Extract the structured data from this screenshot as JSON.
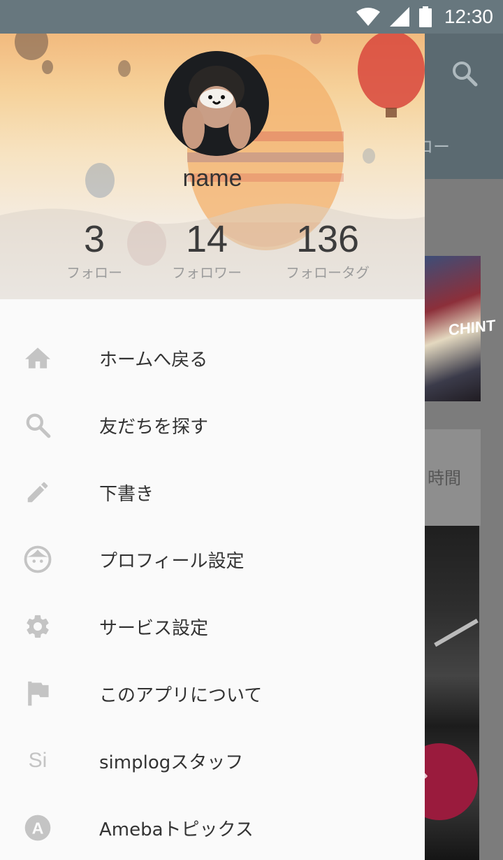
{
  "status_bar": {
    "time": "12:30"
  },
  "background_app": {
    "tab_fragment": "ロー",
    "card_sign": "CHINT",
    "card_time": "時間"
  },
  "drawer": {
    "profile": {
      "name": "name"
    },
    "stats": [
      {
        "value": "3",
        "label": "フォロー"
      },
      {
        "value": "14",
        "label": "フォロワー"
      },
      {
        "value": "136",
        "label": "フォロータグ"
      }
    ],
    "menu": [
      {
        "icon": "home-icon",
        "label": "ホームへ戻る"
      },
      {
        "icon": "search-icon",
        "label": "友だちを探す"
      },
      {
        "icon": "pencil-icon",
        "label": "下書き"
      },
      {
        "icon": "face-icon",
        "label": "プロフィール設定"
      },
      {
        "icon": "gear-icon",
        "label": "サービス設定"
      },
      {
        "icon": "flag-icon",
        "label": "このアプリについて"
      },
      {
        "icon": "si-icon",
        "icon_text": "Si",
        "label": "simplogスタッフ"
      },
      {
        "icon": "ameba-icon",
        "icon_text": "A",
        "label": "Amebaトピックス"
      }
    ]
  },
  "colors": {
    "status_bar": "#67777e",
    "fab": "#9a1b3d",
    "drawer_bg": "#fafafa",
    "icon_gray": "#c4c4c4"
  }
}
